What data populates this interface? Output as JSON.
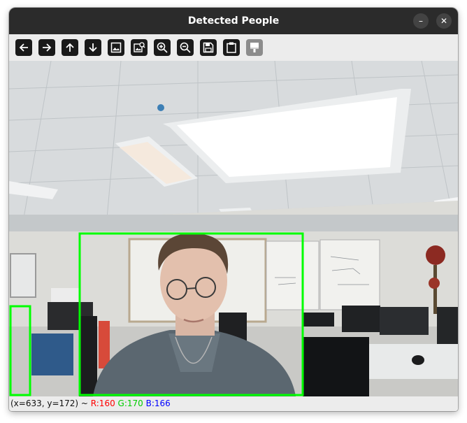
{
  "window": {
    "title": "Detected People",
    "minimize_glyph": "–",
    "close_glyph": "✕"
  },
  "toolbar": {
    "buttons": [
      {
        "name": "pan-left-button",
        "icon": "arrow-left-icon"
      },
      {
        "name": "pan-right-button",
        "icon": "arrow-right-icon"
      },
      {
        "name": "pan-up-button",
        "icon": "arrow-up-icon"
      },
      {
        "name": "pan-down-button",
        "icon": "arrow-down-icon"
      },
      {
        "name": "zoom-fit-button",
        "icon": "image-icon"
      },
      {
        "name": "zoom-original-button",
        "icon": "image-zoom-icon"
      },
      {
        "name": "zoom-in-button",
        "icon": "zoom-in-icon"
      },
      {
        "name": "zoom-out-button",
        "icon": "zoom-out-icon"
      },
      {
        "name": "save-button",
        "icon": "save-icon"
      },
      {
        "name": "copy-clipboard-button",
        "icon": "clipboard-icon"
      },
      {
        "name": "properties-button",
        "icon": "properties-icon",
        "disabled": true
      }
    ]
  },
  "detections": [
    {
      "label": "person",
      "color": "#00ff00"
    },
    {
      "label": "person",
      "color": "#00ff00"
    }
  ],
  "status": {
    "coords": "(x=633, y=172) ~ ",
    "r": "R:160",
    "g": "G:170",
    "b": "B:166",
    "r_color": "#ff0000",
    "g_color": "#00cc00",
    "b_color": "#0000ff"
  }
}
